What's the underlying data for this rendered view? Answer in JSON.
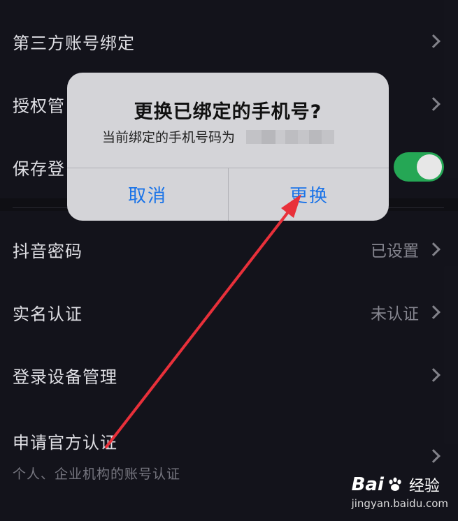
{
  "settings": {
    "third_party": "第三方账号绑定",
    "auth_manage": "授权管",
    "save_login": "保存登",
    "douyin_password": "抖音密码",
    "douyin_password_value": "已设置",
    "real_name": "实名认证",
    "real_name_value": "未认证",
    "device_manage": "登录设备管理",
    "official_verify": "申请官方认证",
    "official_verify_sub": "个人、企业机构的账号认证"
  },
  "dialog": {
    "title": "更换已绑定的手机号?",
    "message": "当前绑定的手机号码为",
    "cancel": "取消",
    "confirm": "更换"
  },
  "watermark": {
    "brand": "Bai",
    "brand_suffix": "经验",
    "url": "jingyan.baidu.com"
  },
  "colors": {
    "background": "#15151d",
    "toggle_on": "#27b05a",
    "dialog_button": "#1a73e8",
    "annotation_arrow": "#e8303a"
  }
}
